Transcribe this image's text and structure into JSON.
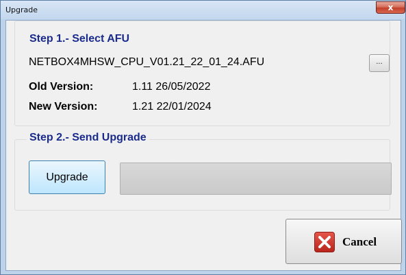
{
  "window": {
    "title": "Upgrade",
    "close_label": "x"
  },
  "step1": {
    "legend": "Step 1.- Select AFU",
    "file_name": "NETBOX4MHSW_CPU_V01.21_22_01_24.AFU",
    "browse_label": "...",
    "old_version_label": "Old Version:",
    "old_version_value": "1.11 26/05/2022",
    "new_version_label": "New Version:",
    "new_version_value": "1.21 22/01/2024"
  },
  "step2": {
    "legend": "Step 2.- Send Upgrade",
    "upgrade_label": "Upgrade",
    "progress": 0
  },
  "footer": {
    "cancel_label": "Cancel"
  },
  "icons": {
    "close": "close-icon",
    "cancel": "cancel-x-icon"
  },
  "colors": {
    "legend": "#1a2b8c",
    "progress_track": "#d0d0d0",
    "cancel_icon": "#c8352b"
  }
}
